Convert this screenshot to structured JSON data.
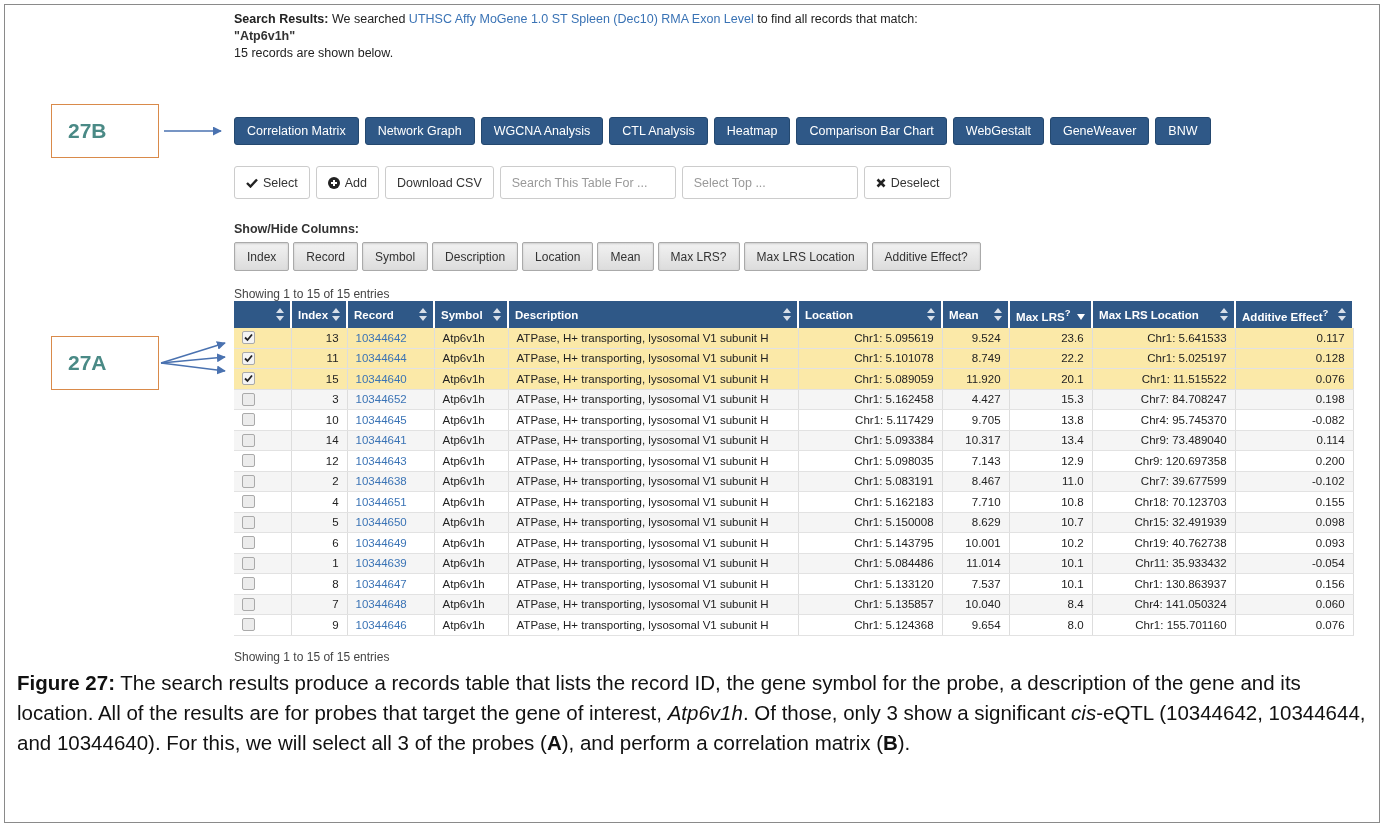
{
  "callouts": [
    {
      "label": "27B"
    },
    {
      "label": "27A"
    }
  ],
  "search_summary": {
    "text": "**Search Results:** We searched ",
    "link": "UTHSC Affy MoGene 1.0 ST Spleen (Dec10) RMA Exon Level",
    "suffix": " to find all records that match:",
    "query": "\"Atp6v1h\"",
    "count": "15 records are shown below."
  },
  "analysis_buttons": [
    "Correlation Matrix",
    "Network Graph",
    "WGCNA Analysis",
    "CTL Analysis",
    "Heatmap",
    "Comparison Bar Chart",
    "WebGestalt",
    "GeneWeaver",
    "BNW"
  ],
  "table_tools": [
    {
      "kind": "check",
      "label": "Select"
    },
    {
      "kind": "add",
      "label": "Add"
    },
    {
      "kind": "plain",
      "label": "Download CSV"
    },
    {
      "kind": "field",
      "placeholder": "Search This Table For ..."
    },
    {
      "kind": "field",
      "placeholder": "Select Top ..."
    },
    {
      "kind": "clear",
      "label": "Deselect"
    }
  ],
  "column_toggles": {
    "title": "Show/Hide Columns:",
    "buttons": [
      "Index",
      "Record",
      "Symbol",
      "Description",
      "Location",
      "Mean",
      "Max LRS?",
      "Max LRS Location",
      "Additive Effect?"
    ]
  },
  "entries_info_top": "Showing 1 to 15 of 15 entries",
  "table": {
    "columns": [
      {
        "label": "Index",
        "sorted_descending": false
      },
      {
        "label": "Record",
        "sorted_descending": false
      },
      {
        "label": "Symbol",
        "sorted_descending": false
      },
      {
        "label": "Description",
        "sorted_descending": false
      },
      {
        "label": "Location",
        "sorted_descending": false
      },
      {
        "label": "Mean",
        "sorted_descending": false
      },
      {
        "label": "Max LRS$^{?}$",
        "sorted_descending": true
      },
      {
        "label": "Max LRS Location",
        "sorted_descending": false
      },
      {
        "label": "Additive Effect$^{?}$",
        "sorted_descending": false
      }
    ],
    "rows": [
      {
        "checked": true,
        "selected": true,
        "cells": [
          "13",
          "10344642",
          "Atp6v1h",
          "ATPase, H+ transporting, lysosomal V1 subunit H",
          "Chr1: 5.095619",
          "9.524",
          "23.6",
          "Chr1: 5.641533",
          "0.117"
        ]
      },
      {
        "checked": true,
        "selected": true,
        "cells": [
          "11",
          "10344644",
          "Atp6v1h",
          "ATPase, H+ transporting, lysosomal V1 subunit H",
          "Chr1: 5.101078",
          "8.749",
          "22.2",
          "Chr1: 5.025197",
          "0.128"
        ]
      },
      {
        "checked": true,
        "selected": true,
        "cells": [
          "15",
          "10344640",
          "Atp6v1h",
          "ATPase, H+ transporting, lysosomal V1 subunit H",
          "Chr1: 5.089059",
          "11.920",
          "20.1",
          "Chr1: 11.515522",
          "0.076"
        ]
      },
      {
        "checked": false,
        "selected": false,
        "cells": [
          "3",
          "10344652",
          "Atp6v1h",
          "ATPase, H+ transporting, lysosomal V1 subunit H",
          "Chr1: 5.162458",
          "4.427",
          "15.3",
          "Chr7: 84.708247",
          "0.198"
        ]
      },
      {
        "checked": false,
        "selected": false,
        "cells": [
          "10",
          "10344645",
          "Atp6v1h",
          "ATPase, H+ transporting, lysosomal V1 subunit H",
          "Chr1: 5.117429",
          "9.705",
          "13.8",
          "Chr4: 95.745370",
          "-0.082"
        ]
      },
      {
        "checked": false,
        "selected": false,
        "cells": [
          "14",
          "10344641",
          "Atp6v1h",
          "ATPase, H+ transporting, lysosomal V1 subunit H",
          "Chr1: 5.093384",
          "10.317",
          "13.4",
          "Chr9: 73.489040",
          "0.114"
        ]
      },
      {
        "checked": false,
        "selected": false,
        "cells": [
          "12",
          "10344643",
          "Atp6v1h",
          "ATPase, H+ transporting, lysosomal V1 subunit H",
          "Chr1: 5.098035",
          "7.143",
          "12.9",
          "Chr9: 120.697358",
          "0.200"
        ]
      },
      {
        "checked": false,
        "selected": false,
        "cells": [
          "2",
          "10344638",
          "Atp6v1h",
          "ATPase, H+ transporting, lysosomal V1 subunit H",
          "Chr1: 5.083191",
          "8.467",
          "11.0",
          "Chr7: 39.677599",
          "-0.102"
        ]
      },
      {
        "checked": false,
        "selected": false,
        "cells": [
          "4",
          "10344651",
          "Atp6v1h",
          "ATPase, H+ transporting, lysosomal V1 subunit H",
          "Chr1: 5.162183",
          "7.710",
          "10.8",
          "Chr18: 70.123703",
          "0.155"
        ]
      },
      {
        "checked": false,
        "selected": false,
        "cells": [
          "5",
          "10344650",
          "Atp6v1h",
          "ATPase, H+ transporting, lysosomal V1 subunit H",
          "Chr1: 5.150008",
          "8.629",
          "10.7",
          "Chr15: 32.491939",
          "0.098"
        ]
      },
      {
        "checked": false,
        "selected": false,
        "cells": [
          "6",
          "10344649",
          "Atp6v1h",
          "ATPase, H+ transporting, lysosomal V1 subunit H",
          "Chr1: 5.143795",
          "10.001",
          "10.2",
          "Chr19: 40.762738",
          "0.093"
        ]
      },
      {
        "checked": false,
        "selected": false,
        "cells": [
          "1",
          "10344639",
          "Atp6v1h",
          "ATPase, H+ transporting, lysosomal V1 subunit H",
          "Chr1: 5.084486",
          "11.014",
          "10.1",
          "Chr11: 35.933432",
          "-0.054"
        ]
      },
      {
        "checked": false,
        "selected": false,
        "cells": [
          "8",
          "10344647",
          "Atp6v1h",
          "ATPase, H+ transporting, lysosomal V1 subunit H",
          "Chr1: 5.133120",
          "7.537",
          "10.1",
          "Chr1: 130.863937",
          "0.156"
        ]
      },
      {
        "checked": false,
        "selected": false,
        "cells": [
          "7",
          "10344648",
          "Atp6v1h",
          "ATPase, H+ transporting, lysosomal V1 subunit H",
          "Chr1: 5.135857",
          "10.040",
          "8.4",
          "Chr4: 141.050324",
          "0.060"
        ]
      },
      {
        "checked": false,
        "selected": false,
        "cells": [
          "9",
          "10344646",
          "Atp6v1h",
          "ATPase, H+ transporting, lysosomal V1 subunit H",
          "Chr1: 5.124368",
          "9.654",
          "8.0",
          "Chr1: 155.701160",
          "0.076"
        ]
      }
    ]
  },
  "entries_info_bottom": "Showing 1 to 15 of 15 entries",
  "caption": "**Figure 27:** The search results produce a records table that lists the record ID, the gene symbol for the probe, a description of the gene and its location. All of the results are for probes that target the gene of interest, *Atp6v1h*. Of those, only 3 show a significant *cis*-eQTL (10344642, 10344644, and 10344640). For this, we will select all 3 of the probes (**A**), and perform a correlation matrix (**B**)."
}
